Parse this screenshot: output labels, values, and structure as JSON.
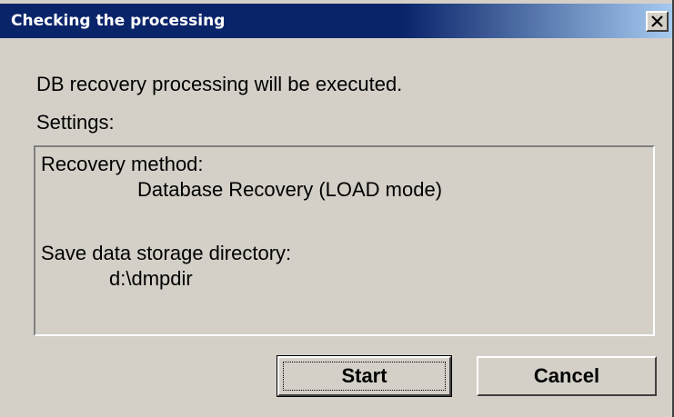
{
  "window": {
    "title": "Checking the processing",
    "close_symbol": "close-icon"
  },
  "message": "DB recovery processing will be executed.",
  "settings_label": "Settings:",
  "settings": {
    "recovery_method_label": "Recovery method:",
    "recovery_method_value": "Database Recovery (LOAD mode)",
    "save_dir_label": "Save data storage directory:",
    "save_dir_value": "d:\\dmpdir"
  },
  "buttons": {
    "start": "Start",
    "cancel": "Cancel"
  },
  "colors": {
    "title_bar": "#0a246a",
    "dialog_bg": "#d4d0c8"
  }
}
